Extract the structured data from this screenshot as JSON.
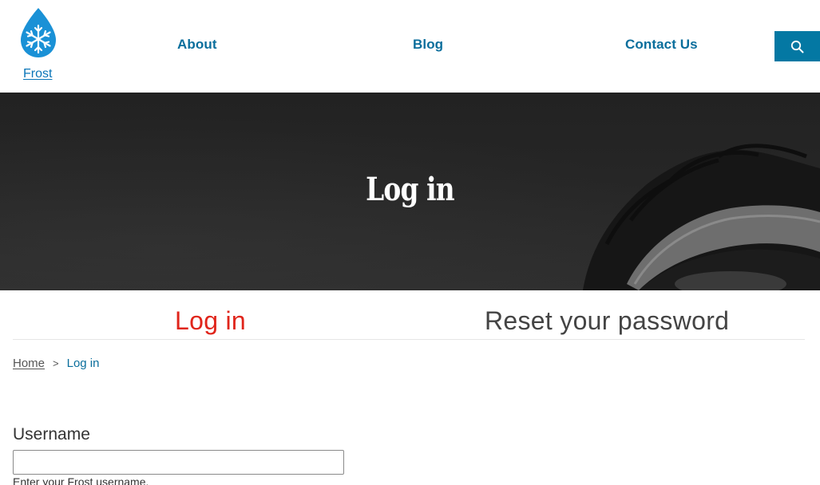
{
  "site": {
    "name": "Frost",
    "logo_icon": "snowflake-drop-icon",
    "brand_color": "#1a91d6"
  },
  "nav": {
    "items": [
      {
        "label": "About"
      },
      {
        "label": "Blog"
      },
      {
        "label": "Contact Us"
      }
    ],
    "search_icon": "search-icon",
    "accent": "#0478a3"
  },
  "hero": {
    "title": "Log in"
  },
  "tabs": {
    "items": [
      {
        "label": "Log in",
        "active": true
      },
      {
        "label": "Reset your password",
        "active": false
      }
    ],
    "active_color": "#e0251b"
  },
  "breadcrumb": {
    "home": "Home",
    "separator": ">",
    "current": "Log in"
  },
  "form": {
    "username": {
      "label": "Username",
      "value": "",
      "help": "Enter your Frost username."
    }
  }
}
